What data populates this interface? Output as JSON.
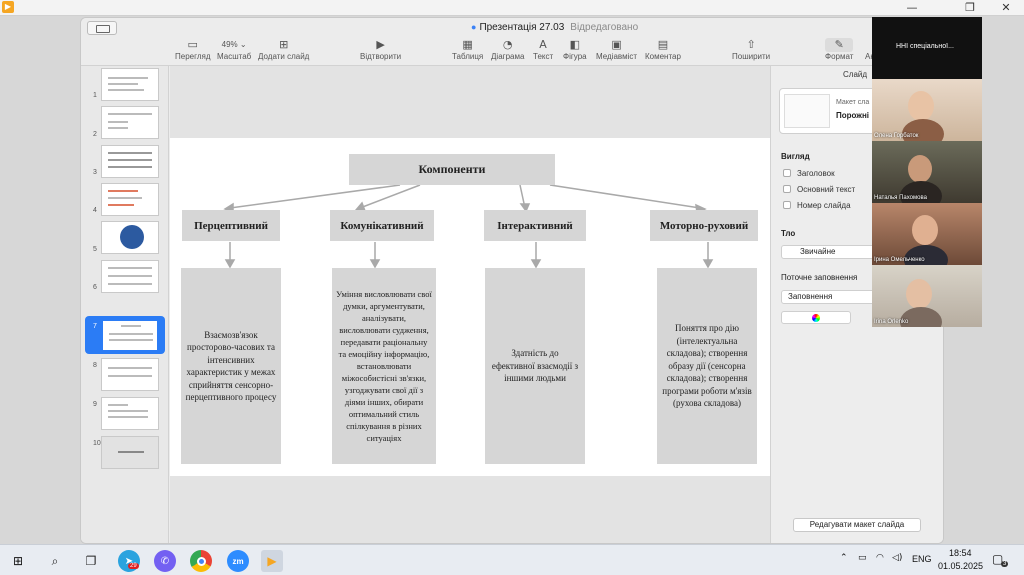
{
  "host": {
    "controls": [
      "—",
      "❐",
      "✕"
    ]
  },
  "window": {
    "title": "Презентація 27.03",
    "status": "Відредаговано"
  },
  "toolbar": [
    {
      "name": "view",
      "label": "Перегляд",
      "icon": "▭"
    },
    {
      "name": "zoom",
      "label": "Масштаб",
      "value": "49% ⌄"
    },
    {
      "name": "add-slide",
      "label": "Додати слайд",
      "icon": "⊞"
    },
    {
      "name": "play",
      "label": "Відтворити",
      "icon": "▶"
    },
    {
      "name": "table",
      "label": "Таблиця",
      "icon": "▦"
    },
    {
      "name": "chart",
      "label": "Діаграма",
      "icon": "◔"
    },
    {
      "name": "text",
      "label": "Текст",
      "icon": "A"
    },
    {
      "name": "shape",
      "label": "Фігура",
      "icon": "◧"
    },
    {
      "name": "media",
      "label": "Медіавміст",
      "icon": "▣"
    },
    {
      "name": "comment",
      "label": "Коментар",
      "icon": "▤"
    },
    {
      "name": "share",
      "label": "Поширити",
      "icon": "⇧"
    },
    {
      "name": "format",
      "label": "Формат",
      "icon": "✎"
    },
    {
      "name": "animate",
      "label": "Ан",
      "icon": ""
    }
  ],
  "navigator": {
    "slides": [
      "1",
      "2",
      "3",
      "4",
      "5",
      "6",
      "7",
      "8",
      "9",
      "10"
    ],
    "selected": "7"
  },
  "slide": {
    "header": "Компоненти",
    "components": [
      "Перцептивний",
      "Комунікативний",
      "Інтерактивний",
      "Моторно-руховий"
    ],
    "descriptions": [
      "Взаємозв'язок просторово-часових та інтенсивних характеристик у межах сприйняття сенсорно-перцептивного процесу",
      "Уміння висловлювати свої думки, аргументувати, аналізувати, висловлювати судження, передавати раціональну та емоційну інформацію, встановлювати міжособистісні зв'язки, узгоджувати свої дії з діями інших, обирати оптимальний стиль спілкування в різних ситуаціях",
      "Здатність до ефективної взаємодії з іншими людьми",
      "Поняття про дію (інтелектуальна складова); створення образу дії (сенсорна складова); створення програми роботи м'язів (рухова складова)"
    ]
  },
  "inspector": {
    "tab": "Слайд",
    "master_label": "Макет сла",
    "master_name": "Порожні",
    "appearance_title": "Вигляд",
    "options": [
      "Заголовок",
      "Основний текст",
      "Номер слайда"
    ],
    "background_title": "Тло",
    "background_value": "Звичайне",
    "fill_title": "Поточне заповнення",
    "fill_value": "Заповнення",
    "edit_master": "Редагувати макет слайда"
  },
  "video": {
    "top_label": "ННІ спеціальної...",
    "participants": [
      "Олена Горбаток",
      "Наталья Пахомова",
      "Ірина Омельченко",
      "Irina Orlenko"
    ]
  },
  "taskbar": {
    "language": "ENG",
    "time": "18:54",
    "date": "01.05.2025",
    "notifications": "3",
    "telegram_badge": "29"
  }
}
